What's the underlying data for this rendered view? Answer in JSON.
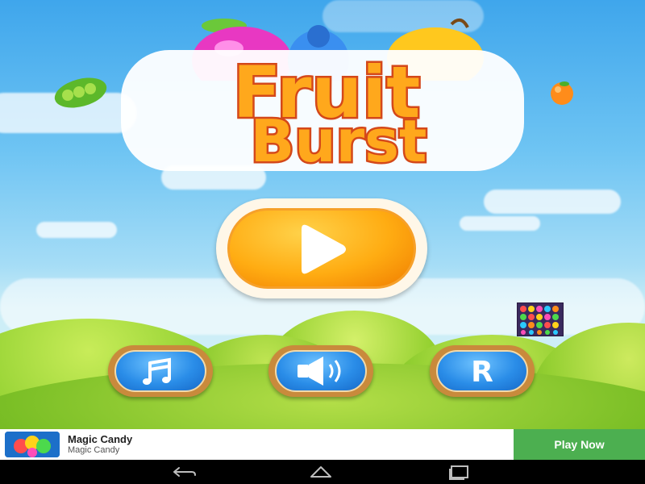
{
  "game": {
    "title_line1": "Fruit",
    "title_line2": "Burst",
    "buttons": {
      "play": "play-icon",
      "music": "music-note-icon",
      "sound": "speaker-icon",
      "rate": "R"
    },
    "colors": {
      "title_fill": "#ffa81c",
      "title_outline": "#d4481a",
      "play_button": "#ffac12",
      "round_buttons": "#2a8de8"
    }
  },
  "ad": {
    "title": "Magic Candy",
    "subtitle": "Magic Candy",
    "cta": "Play Now",
    "cta_color": "#4caf50"
  },
  "navigation": {
    "back": "back-icon",
    "home": "home-icon",
    "recents": "recents-icon"
  }
}
